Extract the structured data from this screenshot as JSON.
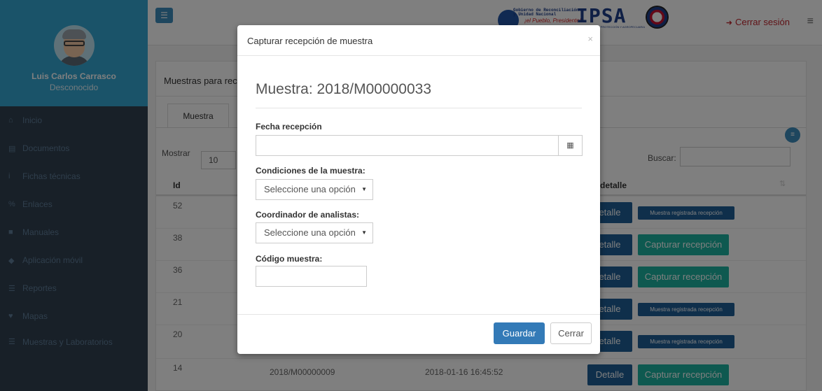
{
  "sidebar": {
    "user_name": "Luis Carlos Carrasco",
    "user_role": "Desconocido",
    "items": [
      {
        "icon": "home-icon",
        "glyph": "⌂",
        "label": "Inicio"
      },
      {
        "icon": "document-icon",
        "glyph": "▤",
        "label": "Documentos"
      },
      {
        "icon": "info-icon",
        "glyph": "i",
        "label": "Fichas técnicas"
      },
      {
        "icon": "link-icon",
        "glyph": "%",
        "label": "Enlaces"
      },
      {
        "icon": "book-icon",
        "glyph": "■",
        "label": "Manuales"
      },
      {
        "icon": "android-icon",
        "glyph": "◆",
        "label": "Aplicación móvil"
      },
      {
        "icon": "list-icon",
        "glyph": "☰",
        "label": "Reportes"
      },
      {
        "icon": "map-marker-icon",
        "glyph": "♥",
        "label": "Mapas"
      },
      {
        "icon": "list-icon",
        "glyph": "☰",
        "label": "Muestras y Laboratorios"
      }
    ]
  },
  "topbar": {
    "brand_line1": "Gobierno de Reconciliación",
    "brand_line2": "y Unidad Nacional",
    "brand_tagline": "¡el Pueblo, Presidente!",
    "brand_name": "IPSA",
    "brand_sub": "DE PROTECCIÓN Y AGROPECUARIA",
    "logout_label": "Cerrar sesión"
  },
  "panel": {
    "title": "Muestras para rec",
    "tab_label": "Muestra",
    "show_label": "Mostrar",
    "show_value": "10",
    "search_label": "Buscar:",
    "col_id": "Id",
    "col_detail": "detalle"
  },
  "table": {
    "rows": [
      {
        "id": "52",
        "code": "",
        "date": "",
        "detail": "etalle",
        "action": "Muestra registrada recepción",
        "action_type": "badge"
      },
      {
        "id": "38",
        "code": "",
        "date": "",
        "detail": "etalle",
        "action": "Capturar recepción",
        "action_type": "button"
      },
      {
        "id": "36",
        "code": "",
        "date": "",
        "detail": "etalle",
        "action": "Capturar recepción",
        "action_type": "button"
      },
      {
        "id": "21",
        "code": "",
        "date": "",
        "detail": "etalle",
        "action": "Muestra registrada recepción",
        "action_type": "badge"
      },
      {
        "id": "20",
        "code": "",
        "date": "",
        "detail": "etalle",
        "action": "Muestra registrada recepción",
        "action_type": "badge"
      },
      {
        "id": "14",
        "code": "2018/M00000009",
        "date": "2018-01-16 16:45:52",
        "detail": "Detalle",
        "action": "Capturar recepción",
        "action_type": "button"
      }
    ]
  },
  "modal": {
    "title": "Capturar recepción de muestra",
    "close": "×",
    "sample_heading": "Muestra: 2018/M00000033",
    "date_label": "Fecha recepción",
    "date_value": "",
    "conditions_label": "Condiciones de la muestra:",
    "conditions_value": "Seleccione una opción",
    "coordinator_label": "Coordinador de analistas:",
    "coordinator_value": "Seleccione una opción",
    "code_label": "Código muestra:",
    "code_value": "",
    "save_label": "Guardar",
    "cancel_label": "Cerrar"
  },
  "colors": {
    "sidebar_bg": "#314151",
    "profile_bg": "#34a7d2",
    "primary": "#337ab7",
    "detail_btn": "#1e5f97",
    "capture_btn": "#1cb3a0",
    "logout": "#c0262e"
  }
}
